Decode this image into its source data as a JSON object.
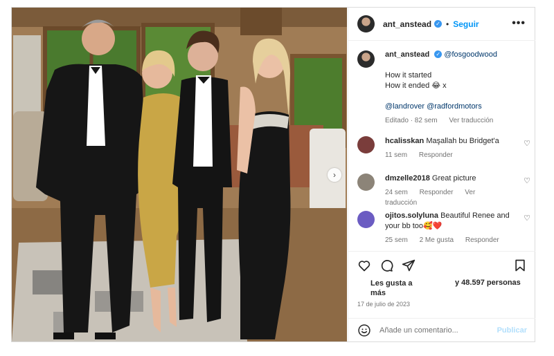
{
  "post": {
    "author": "ant_anstead",
    "follow_label": "Seguir",
    "separator": "•",
    "more_label": "•••"
  },
  "caption": {
    "author": "ant_anstead",
    "mention": "@fosgoodwood",
    "line1": "How it started",
    "line2": "How it ended 😂 x",
    "tags": "@landrover @radfordmotors",
    "edited": "Editado · 82 sem",
    "translate": "Ver traducción"
  },
  "comments": [
    {
      "user": "hcalisskan",
      "text": "Maşallah bu Bridget'a",
      "time": "11 sem",
      "reply": "Responder",
      "extra": "",
      "avatar_color": "#7a3d3b"
    },
    {
      "user": "dmzelle2018",
      "text": "Great picture",
      "time": "24 sem",
      "reply": "Responder",
      "extra": "Ver traducción",
      "avatar_color": "#8c8478"
    },
    {
      "user": "ojitos.solyluna",
      "text": "Beautiful Renee and your bb too🥰❤️",
      "time": "25 sem",
      "reply": "Responder",
      "extra": "2 Me gusta",
      "avatar_color": "#6b5cc2"
    }
  ],
  "actions": {
    "likes_prefix": "Les gusta a",
    "likes_more": "más",
    "likes_count": "y 48.597 personas",
    "date": "17 de julio de 2023"
  },
  "add_comment": {
    "placeholder": "Añade un comentario...",
    "publish": "Publicar"
  },
  "icons": {
    "verified": "verified-badge-icon",
    "heart": "heart-icon",
    "comment": "comment-icon",
    "share": "share-icon",
    "save": "bookmark-icon",
    "emoji": "emoji-icon",
    "next": "chevron-right-icon"
  },
  "colors": {
    "accent": "#0095f6",
    "verified": "#3897f0",
    "muted": "#737373",
    "link": "#00376b"
  }
}
